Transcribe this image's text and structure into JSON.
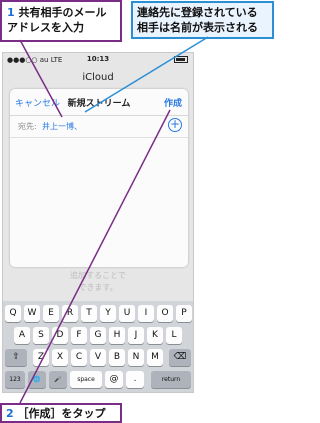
{
  "callouts": {
    "step1_number": "1",
    "step1_text": "共有相手のメールアドレスを入力",
    "note_text": "連絡先に登録されている相手は名前が表示される",
    "step2_number": "2",
    "step2_text": "［作成］をタップ"
  },
  "status_bar": {
    "carrier": "●●●○○ au  LTE",
    "time": "10:13"
  },
  "app_title": "iCloud",
  "sheet": {
    "cancel_label": "キャンセル",
    "title": "新規ストリーム",
    "create_label": "作成",
    "to_label": "宛先:",
    "to_value": "井上一博、",
    "add_icon": "plus-circle-icon"
  },
  "background": {
    "line1": "追加することで",
    "line2": "できます。"
  },
  "keyboard": {
    "row1": [
      "Q",
      "W",
      "E",
      "R",
      "T",
      "Y",
      "U",
      "I",
      "O",
      "P"
    ],
    "row2": [
      "A",
      "S",
      "D",
      "F",
      "G",
      "H",
      "J",
      "K",
      "L"
    ],
    "row3": [
      "Z",
      "X",
      "C",
      "V",
      "B",
      "N",
      "M"
    ],
    "shift": "⇧",
    "delete": "⌫",
    "numbers": "123",
    "globe": "🌐",
    "mic": "🎤",
    "space": "space",
    "at": "@",
    "dot": ".",
    "return": "return"
  },
  "colors": {
    "step_border": "#7a2d86",
    "note_border": "#2b8fd6",
    "link_blue": "#2a7ae2"
  }
}
